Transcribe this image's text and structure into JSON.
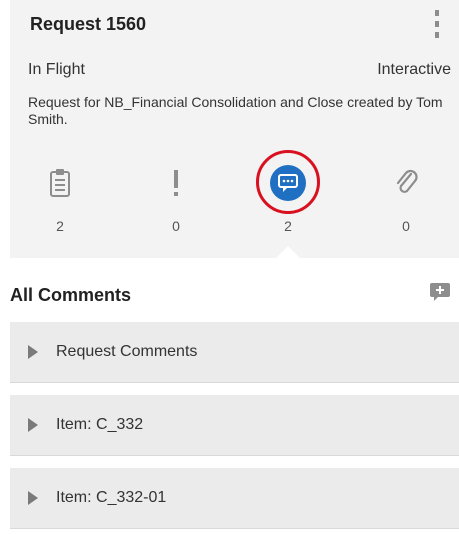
{
  "request": {
    "title": "Request 1560",
    "status": "In Flight",
    "mode": "Interactive",
    "description": "Request for NB_Financial Consolidation and Close created by Tom Smith."
  },
  "metrics": [
    {
      "icon": "clipboard-icon",
      "count": "2"
    },
    {
      "icon": "exclamation-icon",
      "count": "0"
    },
    {
      "icon": "comment-icon",
      "count": "2"
    },
    {
      "icon": "paperclip-icon",
      "count": "0"
    }
  ],
  "comments": {
    "title": "All Comments",
    "add_icon": "add-comment-icon",
    "items": [
      {
        "label": "Request Comments"
      },
      {
        "label": "Item: C_332"
      },
      {
        "label": "Item: C_332-01"
      }
    ]
  },
  "colors": {
    "accent": "#1f6fc2",
    "highlight": "#d8101f",
    "card_bg": "#f3f3f3",
    "row_bg": "#ebebeb",
    "icon_gray": "#8d8d8d"
  }
}
